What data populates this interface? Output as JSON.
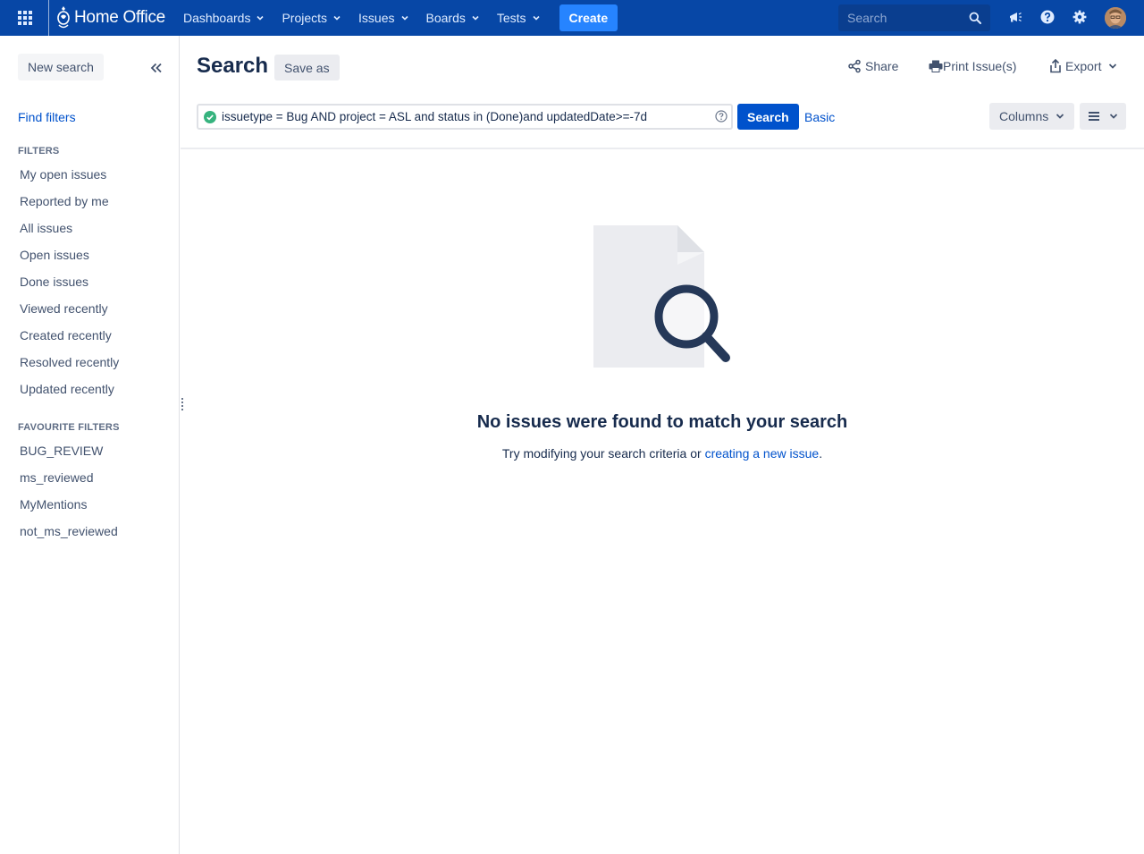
{
  "nav": {
    "brand": "Home Office",
    "items": [
      {
        "label": "Dashboards"
      },
      {
        "label": "Projects"
      },
      {
        "label": "Issues"
      },
      {
        "label": "Boards"
      },
      {
        "label": "Tests"
      }
    ],
    "create_label": "Create",
    "search_placeholder": "Search",
    "icons": [
      "app-switcher-icon",
      "notifications-icon",
      "help-icon",
      "settings-icon",
      "avatar"
    ]
  },
  "sidebar": {
    "new_search_label": "New search",
    "find_filters_label": "Find filters",
    "filters_heading": "FILTERS",
    "filters": [
      "My open issues",
      "Reported by me",
      "All issues",
      "Open issues",
      "Done issues",
      "Viewed recently",
      "Created recently",
      "Resolved recently",
      "Updated recently"
    ],
    "favourites_heading": "FAVOURITE FILTERS",
    "favourites": [
      "BUG_REVIEW",
      "ms_reviewed",
      "MyMentions",
      "not_ms_reviewed"
    ]
  },
  "header": {
    "title": "Search",
    "save_as_label": "Save as",
    "share_label": "Share",
    "print_label": "Print Issue(s)",
    "export_label": "Export"
  },
  "query": {
    "jql": "issuetype = Bug AND project = ASL and status in (Done)and updatedDate>=-7d",
    "search_label": "Search",
    "basic_label": "Basic",
    "columns_label": "Columns"
  },
  "empty_state": {
    "title": "No issues were found to match your search",
    "desc_prefix": "Try modifying your search criteria or ",
    "desc_link": "creating a new issue",
    "desc_suffix": "."
  },
  "colors": {
    "nav_bg": "#0747a6",
    "create_bg": "#2684ff",
    "primary_btn": "#0052cc",
    "link": "#0052cc",
    "valid_check": "#36b37e"
  }
}
